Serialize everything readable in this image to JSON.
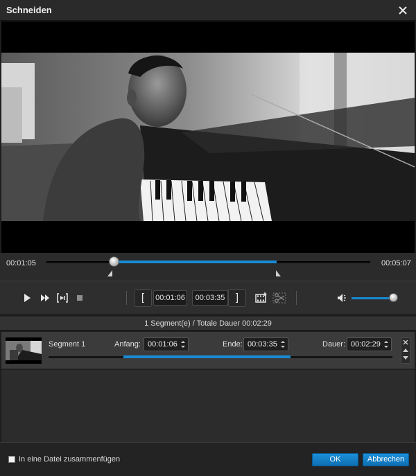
{
  "window": {
    "title": "Schneiden",
    "close_icon": "close-icon"
  },
  "timeline": {
    "current_time": "00:01:05",
    "total_time": "00:05:07",
    "playhead_fraction": 0.21,
    "selection_start_fraction": 0.21,
    "selection_end_fraction": 0.71
  },
  "controls": {
    "start_bracket": "[",
    "start_time": "00:01:06",
    "end_time": "00:03:35",
    "end_bracket": "]",
    "volume_fraction": 1.0,
    "icons": {
      "play": "play-icon",
      "fast_forward": "fast-forward-icon",
      "frame_step": "frame-step-icon",
      "stop": "stop-icon",
      "new_segment": "film-add-icon",
      "cut": "scissors-icon",
      "volume": "speaker-icon"
    }
  },
  "summary": {
    "text": "1 Segment(e) / Totale Dauer 00:02:29"
  },
  "segments": [
    {
      "name": "Segment 1",
      "start_label": "Anfang:",
      "start": "00:01:06",
      "end_label": "Ende:",
      "end": "00:03:35",
      "duration_label": "Dauer:",
      "duration": "00:02:29"
    }
  ],
  "footer": {
    "merge_checkbox_label": "In eine Datei zusammenfügen",
    "merge_checked": false,
    "ok_label": "OK",
    "cancel_label": "Abbrechen"
  },
  "colors": {
    "accent": "#1a8ad4",
    "background": "#1e1e1e"
  }
}
